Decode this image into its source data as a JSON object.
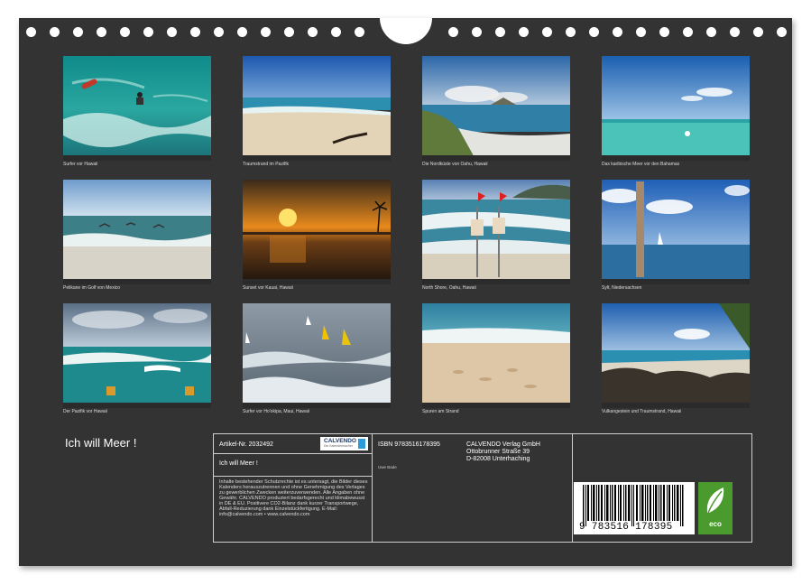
{
  "calendar": {
    "title": "Ich will Meer !",
    "photos": [
      {
        "caption": "Surfer vor Hawaii"
      },
      {
        "caption": "Traumstrand im Pazifik"
      },
      {
        "caption": "Die Nordküste von Oahu, Hawaii"
      },
      {
        "caption": "Das karibische Meer vor den Bahamas"
      },
      {
        "caption": "Pelikane im Golf von Mexico"
      },
      {
        "caption": "Sunset vor Kauai, Hawaii"
      },
      {
        "caption": "North Shore, Oahu, Hawaii"
      },
      {
        "caption": "Sylt, Niedersachsen"
      },
      {
        "caption": "Der Pazifik vor Hawaii"
      },
      {
        "caption": "Surfer vor Ho'okipa, Maui, Hawaii"
      },
      {
        "caption": "Spuren am Strand"
      },
      {
        "caption": "Vulkangestein und Traumstrand, Hawaii"
      }
    ]
  },
  "info": {
    "article": "Artikel-Nr. 2032492",
    "logo_text": "CALVENDO",
    "logo_sub": "Die Kalendermacher",
    "calendar_title": "Ich will Meer !",
    "legal": "Inhalte bestehender Schutzrechte ist es untersagt, die Bilder dieses Kalenders herauszutrennen und ohne Genehmigung des Verlages zu gewerblichen Zwecken weiterzuverwenden. Alle Angaben ohne Gewähr. CALVENDO produziert bedarfsgerecht und klimabewusst in DE & EU. Positivere CO2-Bilanz dank kurzer Transportwege, Abfall-Reduzierung dank Einzelstückfertigung. E-Mail: info@calvendo.com • www.calvendo.com",
    "isbn": "ISBN 9783516178395",
    "author": "Uwe Bade",
    "publisher_name": "CALVENDO Verlag GmbH",
    "publisher_street": "Ottobrunner Straße 39",
    "publisher_city": "D-82008 Unterhaching",
    "barcode_number": "9 783516 178395",
    "eco_label": "eco"
  }
}
